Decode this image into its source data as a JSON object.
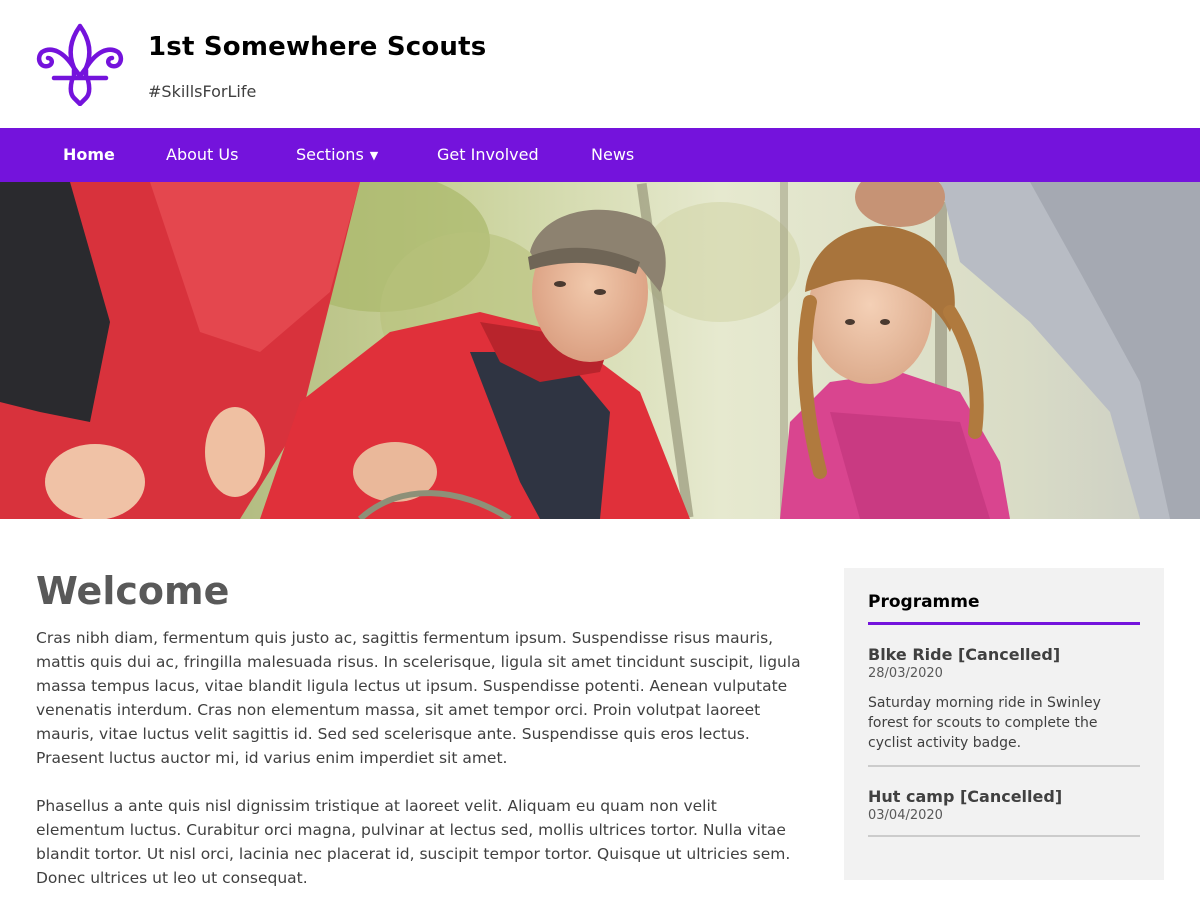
{
  "header": {
    "title": "1st Somewhere Scouts",
    "tagline": "#SkillsForLife",
    "logo_icon": "fleur-de-lis-icon",
    "brand_color": "#7413dc"
  },
  "nav": {
    "items": [
      {
        "label": "Home",
        "active": true
      },
      {
        "label": "About Us"
      },
      {
        "label": "Sections",
        "has_dropdown": true,
        "caret": "▼"
      },
      {
        "label": "Get Involved"
      },
      {
        "label": "News"
      }
    ]
  },
  "hero": {
    "image": "photo of a scout leader in a red jacket and cap with a girl in a pink hoodie tying rope outdoors"
  },
  "main": {
    "heading": "Welcome",
    "paragraphs": [
      "Cras nibh diam, fermentum quis justo ac, sagittis fermentum ipsum. Suspendisse risus mauris, mattis quis dui ac, fringilla malesuada risus. In scelerisque, ligula sit amet tincidunt suscipit, ligula massa tempus lacus, vitae blandit ligula lectus ut ipsum. Suspendisse potenti. Aenean vulputate venenatis interdum. Cras non elementum massa, sit amet tempor orci. Proin volutpat laoreet mauris, vitae luctus velit sagittis id. Sed sed scelerisque ante. Suspendisse quis eros lectus. Praesent luctus auctor mi, id varius enim imperdiet sit amet.",
      "Phasellus a ante quis nisl dignissim tristique at laoreet velit. Aliquam eu quam non velit elementum luctus. Curabitur orci magna, pulvinar at lectus sed, mollis ultrices tortor. Nulla vitae blandit tortor. Ut nisl orci, lacinia nec placerat id, suscipit tempor tortor. Quisque ut ultricies sem. Donec ultrices ut leo ut consequat."
    ]
  },
  "sidebar": {
    "title": "Programme",
    "events": [
      {
        "title": "Blke Ride [Cancelled]",
        "date": "28/03/2020",
        "description": "Saturday morning ride in Swinley forest for scouts to complete the cyclist activity badge."
      },
      {
        "title": "Hut camp [Cancelled]",
        "date": "03/04/2020"
      }
    ]
  }
}
